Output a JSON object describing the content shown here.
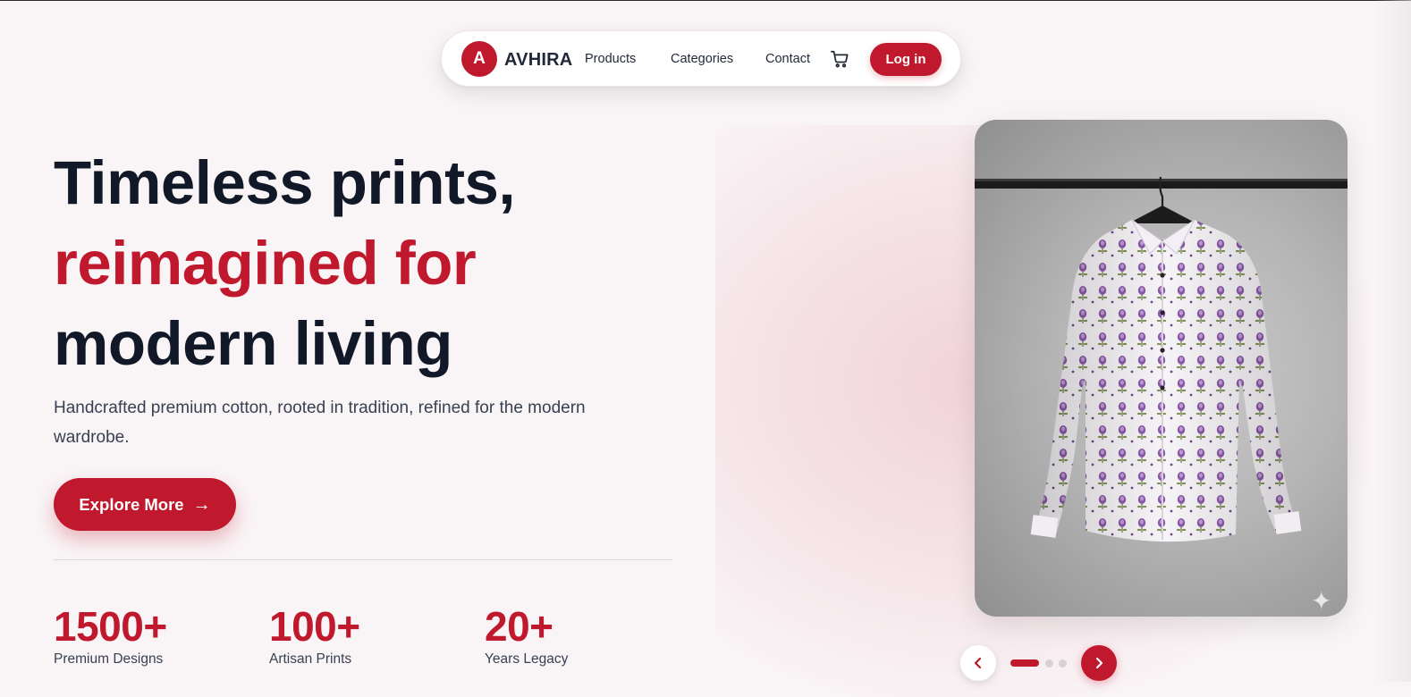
{
  "nav": {
    "logo_letter": "A",
    "brand": "AVHIRA",
    "links": [
      "Products",
      "Categories",
      "Contact"
    ],
    "cart_icon": "cart-icon",
    "login_label": "Log in"
  },
  "hero": {
    "title_line1": "Timeless prints,",
    "title_line2": "reimagined for",
    "title_line3": "modern living",
    "subtitle": "Handcrafted premium cotton, rooted in tradition, refined for the modern wardrobe.",
    "cta_label": "Explore More",
    "cta_icon": "arrow-right-icon"
  },
  "stats": [
    {
      "value": "1500+",
      "label": "Premium Designs"
    },
    {
      "value": "100+",
      "label": "Artisan Prints"
    },
    {
      "value": "20+",
      "label": "Years Legacy"
    }
  ],
  "carousel": {
    "prev_icon": "chevron-left-icon",
    "next_icon": "chevron-right-icon",
    "slides_count": 3,
    "active_index": 0,
    "image_subject": "patterned shirt on hanger",
    "badge_icon": "sparkle-icon"
  },
  "colors": {
    "accent": "#c0182d",
    "background": "#f9f4f6",
    "text_dark": "#111827"
  }
}
